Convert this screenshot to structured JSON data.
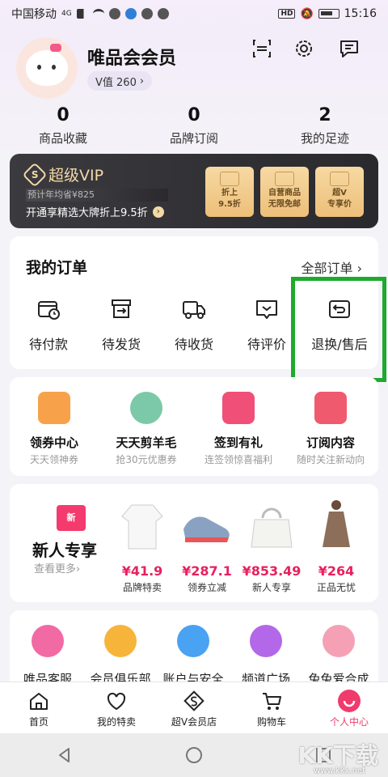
{
  "status_bar": {
    "carrier": "中国移动",
    "network": "4G",
    "hd": "HD",
    "time": "15:16"
  },
  "profile": {
    "name": "唯品会会员",
    "v_value": "V值 260",
    "v_arrow": "›"
  },
  "stats": [
    {
      "value": "0",
      "label": "商品收藏"
    },
    {
      "value": "0",
      "label": "品牌订阅"
    },
    {
      "value": "2",
      "label": "我的足迹"
    }
  ],
  "vip": {
    "logo_letter": "S",
    "title": "超级VIP",
    "subtitle": "预计年均省¥825",
    "cta": "开通享精选大牌折上9.5折",
    "cta_arrow": "›",
    "cards": [
      {
        "line1": "折上",
        "line2": "9.5折"
      },
      {
        "line1": "自营商品",
        "line2": "无限免邮"
      },
      {
        "line1": "超V",
        "line2": "专享价"
      }
    ],
    "colors": {
      "gold": "#f3d9a6",
      "bg": "#2a292d"
    }
  },
  "orders": {
    "title": "我的订单",
    "all": "全部订单 ›",
    "items": [
      {
        "label": "待付款",
        "icon": "wallet-clock-icon"
      },
      {
        "label": "待发货",
        "icon": "box-arrow-icon"
      },
      {
        "label": "待收货",
        "icon": "truck-icon"
      },
      {
        "label": "待评价",
        "icon": "chat-review-icon"
      },
      {
        "label": "退换/售后",
        "icon": "return-icon"
      }
    ]
  },
  "features": [
    {
      "title": "领券中心",
      "sub": "天天领神券",
      "icon": "coupon-icon",
      "color": "#f7a24a"
    },
    {
      "title": "天天剪羊毛",
      "sub": "抢30元优惠券",
      "icon": "sheep-icon",
      "color": "#7bc9a8"
    },
    {
      "title": "签到有礼",
      "sub": "连签领惊喜福利",
      "icon": "checkin-icon",
      "color": "#f04f78"
    },
    {
      "title": "订阅内容",
      "sub": "随时关注新动向",
      "icon": "subscribe-icon",
      "color": "#f05a6e"
    }
  ],
  "newcomer": {
    "badge": "新",
    "title": "新人专享",
    "more": "查看更多›",
    "products": [
      {
        "price": "¥41.9",
        "tag": "品牌特卖",
        "icon": "white-sweater-icon"
      },
      {
        "price": "¥287.1",
        "tag": "领券立减",
        "icon": "sneaker-icon"
      },
      {
        "price": "¥853.49",
        "tag": "新人专享",
        "icon": "handbag-icon"
      },
      {
        "price": "¥264",
        "tag": "正品无忧",
        "icon": "coat-icon"
      }
    ],
    "price_color": "#e8205f"
  },
  "services": [
    {
      "label": "唯品客服",
      "icon": "headset-icon",
      "color": "#f26aa4"
    },
    {
      "label": "会员俱乐部",
      "icon": "crown-icon",
      "color": "#f7b43a"
    },
    {
      "label": "账户与安全",
      "icon": "shield-icon",
      "color": "#4aa2f2"
    },
    {
      "label": "频道广场",
      "icon": "grid-icon",
      "color": "#b268e8"
    },
    {
      "label": "兔兔爱合成",
      "icon": "bunny-icon",
      "color": "#f5a0b5"
    }
  ],
  "tabs": [
    {
      "label": "首页",
      "icon": "home-icon"
    },
    {
      "label": "我的特卖",
      "icon": "heart-icon"
    },
    {
      "label": "超V会员店",
      "icon": "svip-icon"
    },
    {
      "label": "购物车",
      "icon": "cart-icon"
    },
    {
      "label": "个人中心",
      "icon": "profile-icon",
      "active": true
    }
  ],
  "accent": "#f03c6d",
  "watermark": {
    "text": "KK下载",
    "url": "www.kkx.net"
  }
}
